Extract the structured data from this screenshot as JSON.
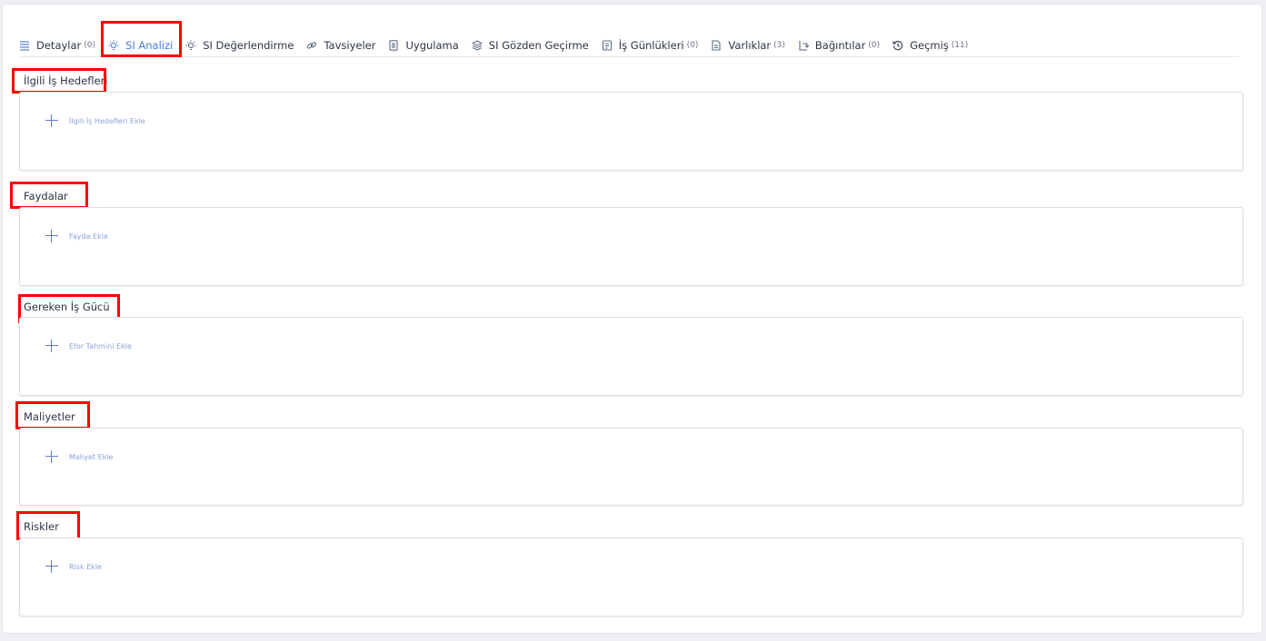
{
  "tabs": [
    {
      "label": "Detaylar",
      "count": "(0)",
      "icon": "list-icon"
    },
    {
      "label": "SI Analizi",
      "count": "",
      "icon": "bulb-icon",
      "active": true
    },
    {
      "label": "SI Değerlendirme",
      "count": "",
      "icon": "bulb-icon"
    },
    {
      "label": "Tavsiyeler",
      "count": "",
      "icon": "link-icon"
    },
    {
      "label": "Uygulama",
      "count": "",
      "icon": "document-icon"
    },
    {
      "label": "SI Gözden Geçirme",
      "count": "",
      "icon": "layers-icon"
    },
    {
      "label": "İş Günlükleri",
      "count": "(0)",
      "icon": "log-icon"
    },
    {
      "label": "Varlıklar",
      "count": "(3)",
      "icon": "asset-icon"
    },
    {
      "label": "Bağıntılar",
      "count": "(0)",
      "icon": "relation-icon"
    },
    {
      "label": "Geçmiş",
      "count": "(11)",
      "icon": "history-icon"
    }
  ],
  "sections": [
    {
      "title": "İlgili İş Hedefleri",
      "add_label": "İlgili İş Hedefleri Ekle"
    },
    {
      "title": "Faydalar",
      "add_label": "Fayda Ekle"
    },
    {
      "title": "Gereken İş Gücü",
      "add_label": "Efor Tahmini Ekle"
    },
    {
      "title": "Maliyetler",
      "add_label": "Maliyet Ekle"
    },
    {
      "title": "Riskler",
      "add_label": "Risk Ekle"
    }
  ],
  "colors": {
    "accent": "#4a7bd0",
    "highlight": "#ff0000"
  }
}
